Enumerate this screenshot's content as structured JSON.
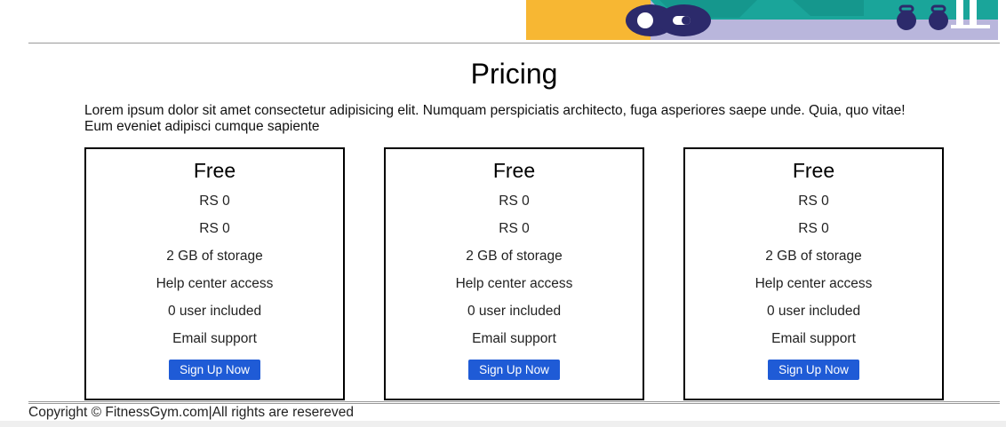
{
  "hero": {
    "illustration_icon": "gym-equipment-illustration",
    "colors": {
      "yellow": "#f7b733",
      "teal": "#1aa59a",
      "lavender": "#b9b6dc",
      "navy": "#2c2a6b"
    }
  },
  "pricing": {
    "title": "Pricing",
    "intro": "Lorem ipsum dolor sit amet consectetur adipisicing elit. Numquam perspiciatis architecto, fuga asperiores saepe unde. Quia, quo vitae! Eum eveniet adipisci cumque sapiente",
    "plans": [
      {
        "name": "Free",
        "price_1": "RS 0",
        "price_2": "RS 0",
        "storage": "2 GB of storage",
        "help": "Help center access",
        "users": "0 user included",
        "support": "Email support",
        "button_label": "Sign Up Now"
      },
      {
        "name": "Free",
        "price_1": "RS 0",
        "price_2": "RS 0",
        "storage": "2 GB of storage",
        "help": "Help center access",
        "users": "0 user included",
        "support": "Email support",
        "button_label": "Sign Up Now"
      },
      {
        "name": "Free",
        "price_1": "RS 0",
        "price_2": "RS 0",
        "storage": "2 GB of storage",
        "help": "Help center access",
        "users": "0 user included",
        "support": "Email support",
        "button_label": "Sign Up Now"
      }
    ],
    "button_color": "#1f5bd6"
  },
  "footer": {
    "copyright": "Copyright © FitnessGym.com|All rights are resereved"
  }
}
